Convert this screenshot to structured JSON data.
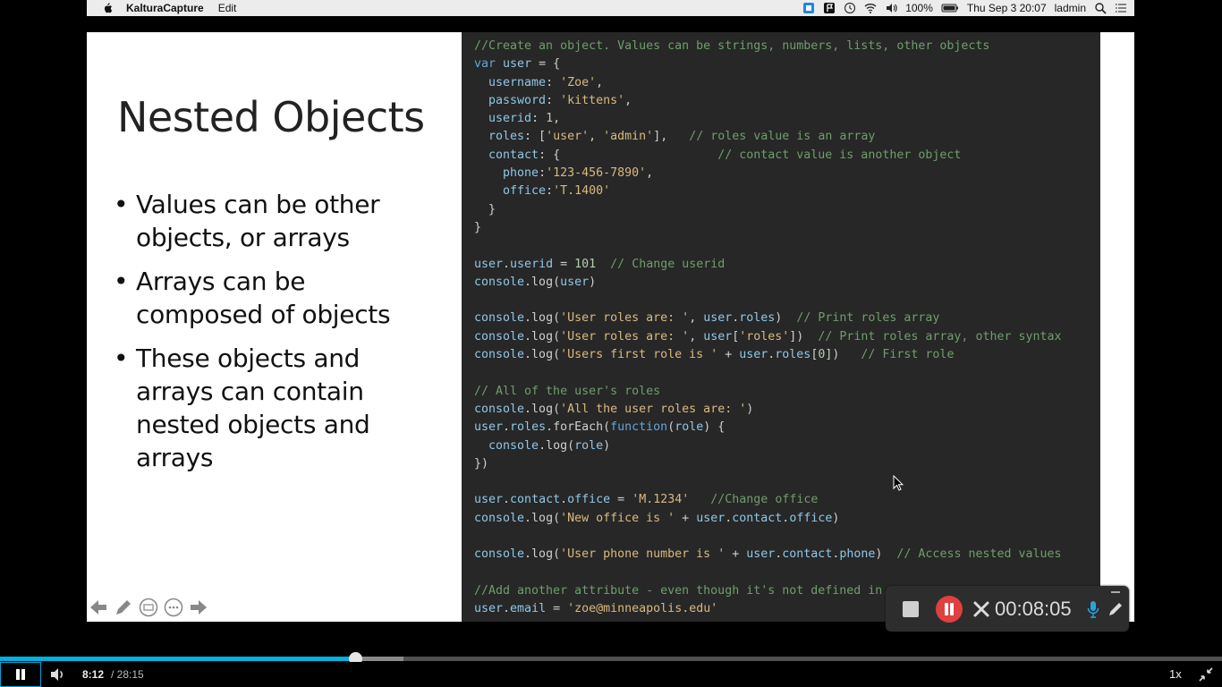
{
  "menubar": {
    "app_name": "KalturaCapture",
    "menu_edit": "Edit",
    "battery": "100%",
    "datetime": "Thu Sep 3  20:07",
    "user": "ladmin"
  },
  "slide": {
    "title": "Nested Objects",
    "bullets": [
      "Values can be other objects, or arrays",
      "Arrays can be composed of objects",
      "These objects and arrays can contain nested objects and arrays"
    ]
  },
  "recorder": {
    "elapsed": "00:08:05"
  },
  "player": {
    "current_time": "8:12",
    "duration": "/ 28:15",
    "speed": "1x",
    "progress_fraction": 0.2903,
    "buffered_fraction": 0.33
  }
}
